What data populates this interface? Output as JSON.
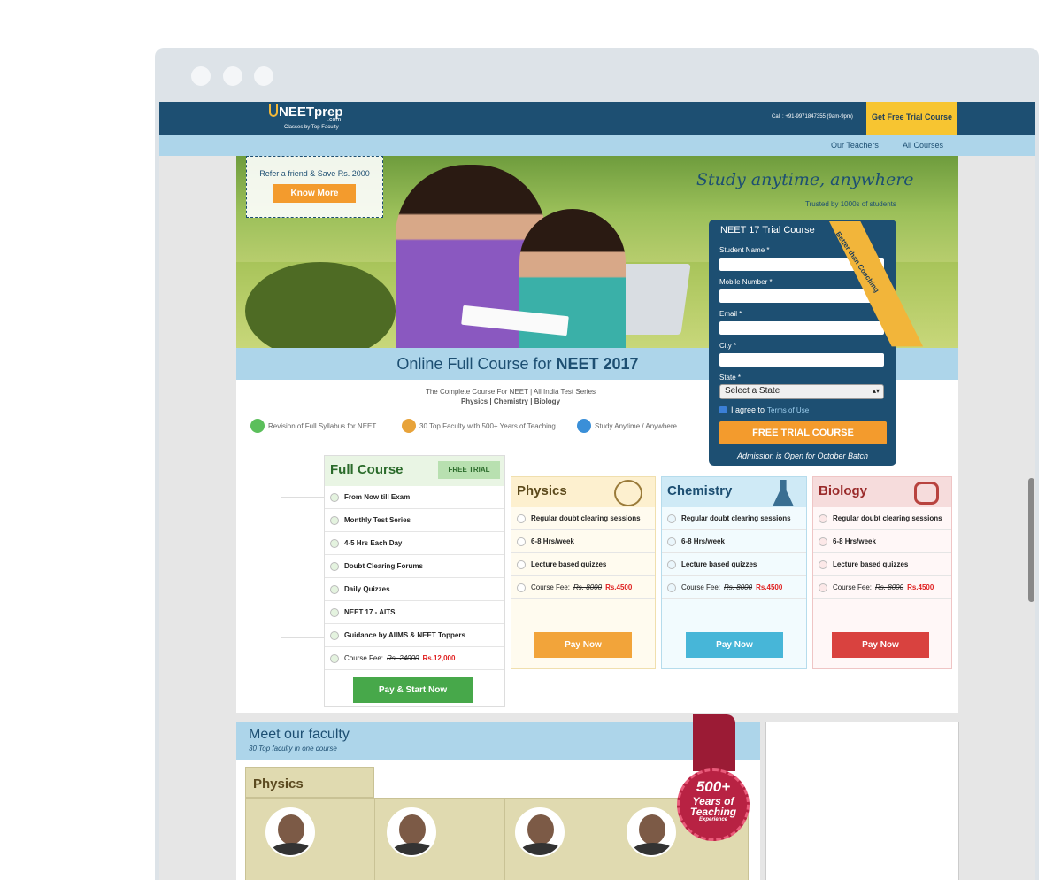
{
  "header": {
    "logo_text": "NEETprep",
    "logo_suffix": ".com",
    "tagline": "Classes by Top Faculty",
    "call": "Call : +91-9971847355 (9am-9pm)",
    "trial_button": "Get Free Trial Course"
  },
  "subnav": {
    "teachers": "Our Teachers",
    "courses": "All Courses"
  },
  "hero": {
    "refer_text": "Refer a friend & Save Rs. 2000",
    "know_more": "Know More",
    "study": "Study anytime, anywhere",
    "trusted": "Trusted by 1000s of students"
  },
  "title": {
    "prefix": "Online Full Course for ",
    "bold": "NEET 2017"
  },
  "intro": {
    "line1": "The Complete Course For NEET | All India Test Series",
    "line2": "Physics | Chemistry | Biology"
  },
  "features": [
    "Revision of Full Syllabus for NEET",
    "30 Top Faculty with 500+ Years of Teaching",
    "Study Anytime / Anywhere"
  ],
  "full_course": {
    "title": "Full Course",
    "badge": "FREE TRIAL",
    "rows": [
      "From Now till Exam",
      "Monthly Test Series",
      "4-5 Hrs Each Day",
      "Doubt Clearing Forums",
      "Daily Quizzes",
      "NEET 17 - AITS",
      "Guidance by AIIMS & NEET Toppers"
    ],
    "fee_label": "Course Fee:",
    "fee_old": "Rs. 24000",
    "fee_new": "Rs.12,000",
    "button": "Pay & Start Now"
  },
  "subjects": [
    {
      "title": "Physics",
      "rows": [
        "Regular doubt clearing sessions",
        "6-8 Hrs/week",
        "Lecture based quizzes"
      ],
      "fee_label": "Course Fee:",
      "fee_old": "Rs. 8000",
      "fee_new": "Rs.4500",
      "button": "Pay Now",
      "color": "#f2a43a"
    },
    {
      "title": "Chemistry",
      "rows": [
        "Regular doubt clearing sessions",
        "6-8 Hrs/week",
        "Lecture based quizzes"
      ],
      "fee_label": "Course Fee:",
      "fee_old": "Rs. 8000",
      "fee_new": "Rs.4500",
      "button": "Pay Now",
      "color": "#47b6d8"
    },
    {
      "title": "Biology",
      "rows": [
        "Regular doubt clearing sessions",
        "6-8 Hrs/week",
        "Lecture based quizzes"
      ],
      "fee_label": "Course Fee:",
      "fee_old": "Rs. 8000",
      "fee_new": "Rs.4500",
      "button": "Pay Now",
      "color": "#d9423f"
    }
  ],
  "form": {
    "title": "NEET 17 Trial Course",
    "ribbon": "Better than Coaching",
    "name_label": "Student Name *",
    "mobile_label": "Mobile Number *",
    "email_label": "Email *",
    "city_label": "City *",
    "state_label": "State *",
    "state_value": "Select a State",
    "agree": "I agree to",
    "terms": "Terms of Use",
    "submit": "FREE TRIAL COURSE",
    "admission": "Admission is Open for October Batch"
  },
  "faculty": {
    "title": "Meet our faculty",
    "subtitle": "30 Top faculty in one course",
    "tab": "Physics",
    "badge_number": "500+",
    "badge_line1": "Years of",
    "badge_line2": "Teaching",
    "badge_line3": "Experience"
  }
}
